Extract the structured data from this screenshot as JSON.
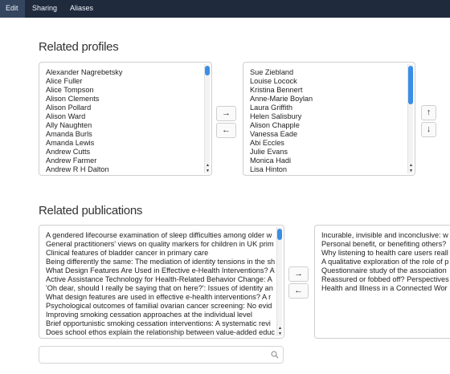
{
  "nav": {
    "tabs": [
      {
        "label": "Edit"
      },
      {
        "label": "Sharing"
      },
      {
        "label": "Aliases"
      }
    ]
  },
  "profiles": {
    "title": "Related profiles",
    "available": [
      "Alexander Nagrebetsky",
      "Alice Fuller",
      "Alice Tompson",
      "Alison Clements",
      "Alison Pollard",
      "Alison Ward",
      "Ally Naughten",
      "Amanda Burls",
      "Amanda Lewis",
      "Andrew Cutts",
      "Andrew Farmer",
      "Andrew R H Dalton"
    ],
    "selected": [
      "Sue Ziebland",
      "Louise Locock",
      "Kristina Bennert",
      "Anne-Marie Boylan",
      "Laura Griffith",
      "Helen Salisbury",
      "Alison Chapple",
      "Vanessa Eade",
      "Abi Eccles",
      "Julie Evans",
      "Monica Hadi",
      "Lisa Hinton"
    ],
    "add_icon": "→",
    "remove_icon": "←",
    "up_icon": "↑",
    "down_icon": "↓"
  },
  "publications": {
    "title": "Related publications",
    "available": [
      "A gendered lifecourse examination of sleep difficulties among older w",
      "General practitioners' views on quality markers for children in UK prim",
      "Clinical features of bladder cancer in primary care",
      "Being differently the same: The mediation of identity tensions in the sh",
      "What Design Features Are Used in Effective e-Health Interventions? A",
      "Active Assistance Technology for Health-Related Behavior Change: A",
      "'Oh dear, should I really be saying that on here?': Issues of identity an",
      "What design features are used in effective e-health interventions? A r",
      "Psychological outcomes of familial ovarian cancer screening: No evid",
      "Improving smoking cessation approaches at the individual level",
      "Brief opportunistic smoking cessation interventions: A systematic revi",
      "Does school ethos explain the relationship between value-added educ"
    ],
    "selected": [
      "Incurable, invisible and inconclusive: w",
      "Personal benefit, or benefiting others?",
      "Why listening to health care users reall",
      "A qualitative exploration of the role of p",
      "Questionnaire study of the association",
      "Reassured or fobbed off? Perspectives",
      "Health and Illness in a Connected Wor"
    ],
    "add_icon": "→",
    "remove_icon": "←",
    "search": {
      "value": "",
      "placeholder": ""
    }
  },
  "colors": {
    "nav_bg": "#1f2a3d",
    "nav_active": "#34455f",
    "scroll_thumb": "#3a8ee6"
  }
}
